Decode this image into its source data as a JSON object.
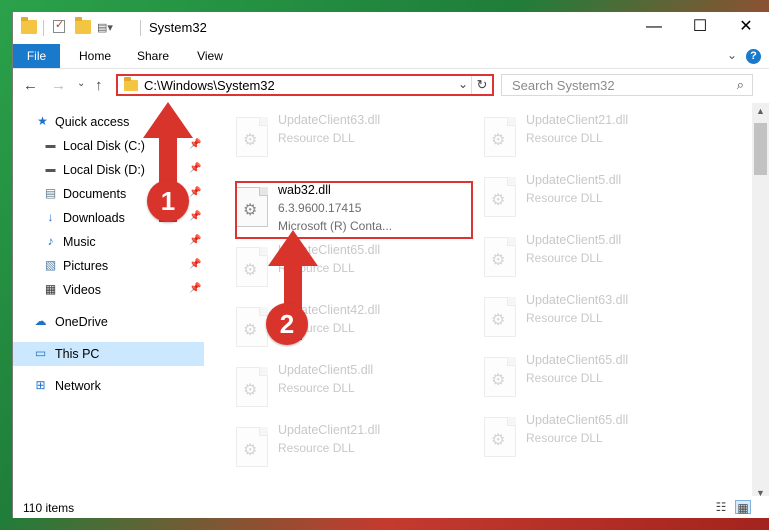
{
  "window": {
    "title": "System32",
    "controls": {
      "minimize": "—",
      "maximize": "☐",
      "close": "✕"
    }
  },
  "ribbon": {
    "tabs": [
      "File",
      "Home",
      "Share",
      "View"
    ],
    "help": "?"
  },
  "address_bar": {
    "path": "C:\\Windows\\System32"
  },
  "search": {
    "placeholder": "Search System32"
  },
  "sidebar": {
    "items": [
      {
        "label": "Quick access",
        "icon": "star-icon"
      },
      {
        "label": "Local Disk (C:)",
        "icon": "drive-icon"
      },
      {
        "label": "Local Disk (D:)",
        "icon": "drive-icon"
      },
      {
        "label": "Documents",
        "icon": "documents-icon"
      },
      {
        "label": "Downloads",
        "icon": "download-icon"
      },
      {
        "label": "Music",
        "icon": "music-icon"
      },
      {
        "label": "Pictures",
        "icon": "pictures-icon"
      },
      {
        "label": "Videos",
        "icon": "videos-icon"
      },
      {
        "label": "OneDrive",
        "icon": "cloud-icon"
      },
      {
        "label": "This PC",
        "icon": "computer-icon"
      },
      {
        "label": "Network",
        "icon": "network-icon"
      }
    ]
  },
  "files": {
    "highlighted": {
      "name": "wab32.dll",
      "version": "6.3.9600.17415",
      "company": "Microsoft (R) Conta..."
    },
    "left_column": [
      {
        "name": "UpdateClient63.dll",
        "type": "Resource DLL"
      },
      {
        "name": "UpdateClient65.dll",
        "type": "Resource DLL"
      },
      {
        "name": "UpdateClient42.dll",
        "type": "Resource DLL"
      },
      {
        "name": "UpdateClient5.dll",
        "type": "Resource DLL"
      },
      {
        "name": "UpdateClient21.dll",
        "type": "Resource DLL"
      }
    ],
    "right_column": [
      {
        "name": "UpdateClient21.dll",
        "type": "Resource DLL"
      },
      {
        "name": "UpdateClient5.dll",
        "type": "Resource DLL"
      },
      {
        "name": "UpdateClient5.dll",
        "type": "Resource DLL"
      },
      {
        "name": "UpdateClient63.dll",
        "type": "Resource DLL"
      },
      {
        "name": "UpdateClient65.dll",
        "type": "Resource DLL"
      },
      {
        "name": "UpdateClient65.dll",
        "type": "Resource DLL"
      }
    ]
  },
  "status": {
    "item_count": "110 items"
  },
  "annotations": {
    "step1": "1",
    "step2": "2",
    "color": "#d9342b"
  }
}
